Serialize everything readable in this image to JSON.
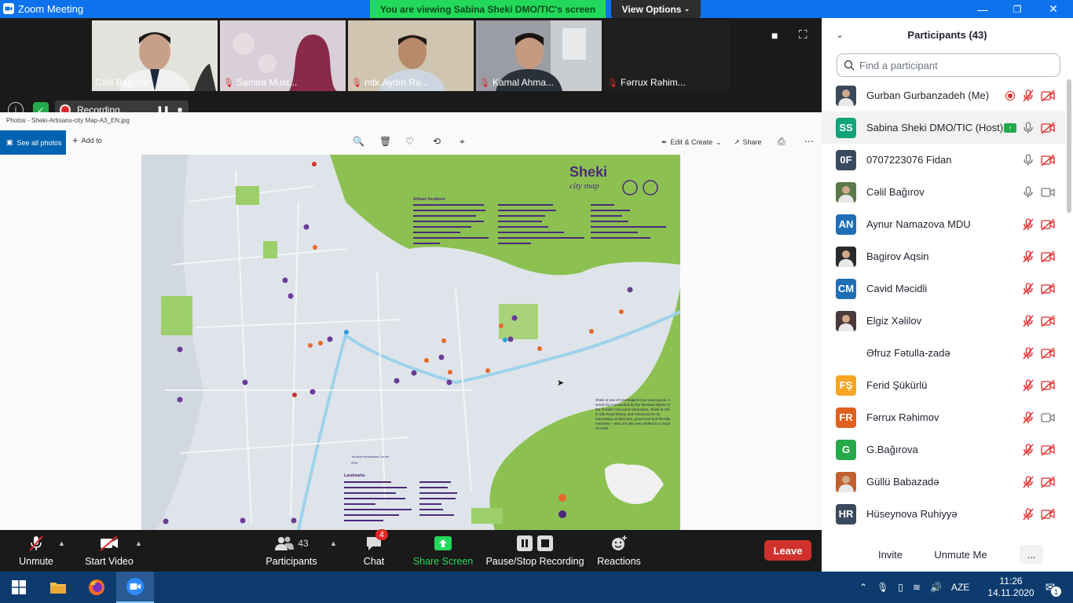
{
  "window": {
    "title": "Zoom Meeting",
    "share_banner": "You are viewing Sabina Sheki DMO/TIC's screen",
    "view_options": "View Options"
  },
  "video_tiles": [
    {
      "name": "Cəlil Bağırov",
      "muted": false
    },
    {
      "name": "Samira Must...",
      "muted": true
    },
    {
      "name": "mtk.Aydın Rə...",
      "muted": true
    },
    {
      "name": "Kamal Ahma...",
      "muted": true
    },
    {
      "name": "Fərrux Rəhim...",
      "muted": true
    }
  ],
  "recording": {
    "label": "Recording..."
  },
  "photos": {
    "doc_title": "Photos - Sheki-Artisans-city Map-A3_EN.jpg",
    "see_all": "See all photos",
    "add_to": "Add to",
    "edit_create": "Edit & Create",
    "share": "Share"
  },
  "map": {
    "title": "Sheki",
    "subtitle": "city map",
    "artisan_heading": "Artisan locations",
    "landmarks_heading": "Landmarks",
    "description": "Sheki is one of Azerbaijan's true travel gems. A small city surrounded by the forested slopes of the Greater Caucasus Mountains, Sheki is rich in Silk Road history and renowned for its fascinating architecture, good food and friendly residents – who are also very skilled in a range of crafts.",
    "legend_tic": "Tourism Information Centre",
    "legend_atm": "ATM"
  },
  "participants": {
    "header": "Participants (43)",
    "search_placeholder": "Find a participant",
    "list": [
      {
        "name": "Gurban Gurbanzadeh (Me)",
        "initials": "",
        "color": "#3a4a5a",
        "mic": "off",
        "cam": "off",
        "photo": true
      },
      {
        "name": "Sabina Sheki DMO/TIC (Host)",
        "initials": "SS",
        "color": "#12a37a",
        "mic": "on",
        "cam": "off",
        "photo": false
      },
      {
        "name": "0707223076 Fidan",
        "initials": "0F",
        "color": "#3a4a5e",
        "mic": "on",
        "cam": "off",
        "photo": false
      },
      {
        "name": "Cəlil Bağırov",
        "initials": "",
        "color": "#5a7a4a",
        "mic": "on",
        "cam": "on",
        "photo": true
      },
      {
        "name": "Aynur Namazova MDU",
        "initials": "AN",
        "color": "#1f6fb5",
        "mic": "off",
        "cam": "off",
        "photo": false
      },
      {
        "name": "Bagirov Aqsin",
        "initials": "",
        "color": "#2a2a2a",
        "mic": "off",
        "cam": "off",
        "photo": true
      },
      {
        "name": "Cavid Məcidli",
        "initials": "CM",
        "color": "#1f6fb5",
        "mic": "off",
        "cam": "off",
        "photo": false
      },
      {
        "name": "Elgiz Xəlilov",
        "initials": "",
        "color": "#4a3a3a",
        "mic": "off",
        "cam": "off",
        "photo": true
      },
      {
        "name": "Əfruz Fətulla-zadə",
        "initials": "",
        "color": "#ffffff",
        "mic": "off",
        "cam": "off",
        "photo": false
      },
      {
        "name": "Ferid Şükürlü",
        "initials": "FŞ",
        "color": "#f5a623",
        "mic": "off",
        "cam": "off",
        "photo": false
      },
      {
        "name": "Fərrux Rəhimov",
        "initials": "FR",
        "color": "#e0601f",
        "mic": "off",
        "cam": "on",
        "photo": false
      },
      {
        "name": "G.Bağırova",
        "initials": "G",
        "color": "#27a84a",
        "mic": "off",
        "cam": "off",
        "photo": false
      },
      {
        "name": "Güllü Babazadə",
        "initials": "",
        "color": "#c06030",
        "mic": "off",
        "cam": "off",
        "photo": true
      },
      {
        "name": "Hüseynova Ruhiyyə",
        "initials": "HR",
        "color": "#3a4a5e",
        "mic": "off",
        "cam": "off",
        "photo": false
      }
    ],
    "invite": "Invite",
    "unmute_me": "Unmute Me",
    "more": "..."
  },
  "controls": {
    "unmute": "Unmute",
    "start_video": "Start Video",
    "participants": "Participants",
    "participants_count": "43",
    "chat": "Chat",
    "chat_badge": "4",
    "share_screen": "Share Screen",
    "pause_stop": "Pause/Stop Recording",
    "reactions": "Reactions",
    "leave": "Leave"
  },
  "taskbar": {
    "lang": "AZE",
    "time": "11:26",
    "date": "14.11.2020",
    "notif": "1"
  },
  "colors": {
    "zoom_blue": "#0e72ed",
    "share_green": "#23d959",
    "leave_red": "#d0312d",
    "map_green": "#8cc152"
  }
}
